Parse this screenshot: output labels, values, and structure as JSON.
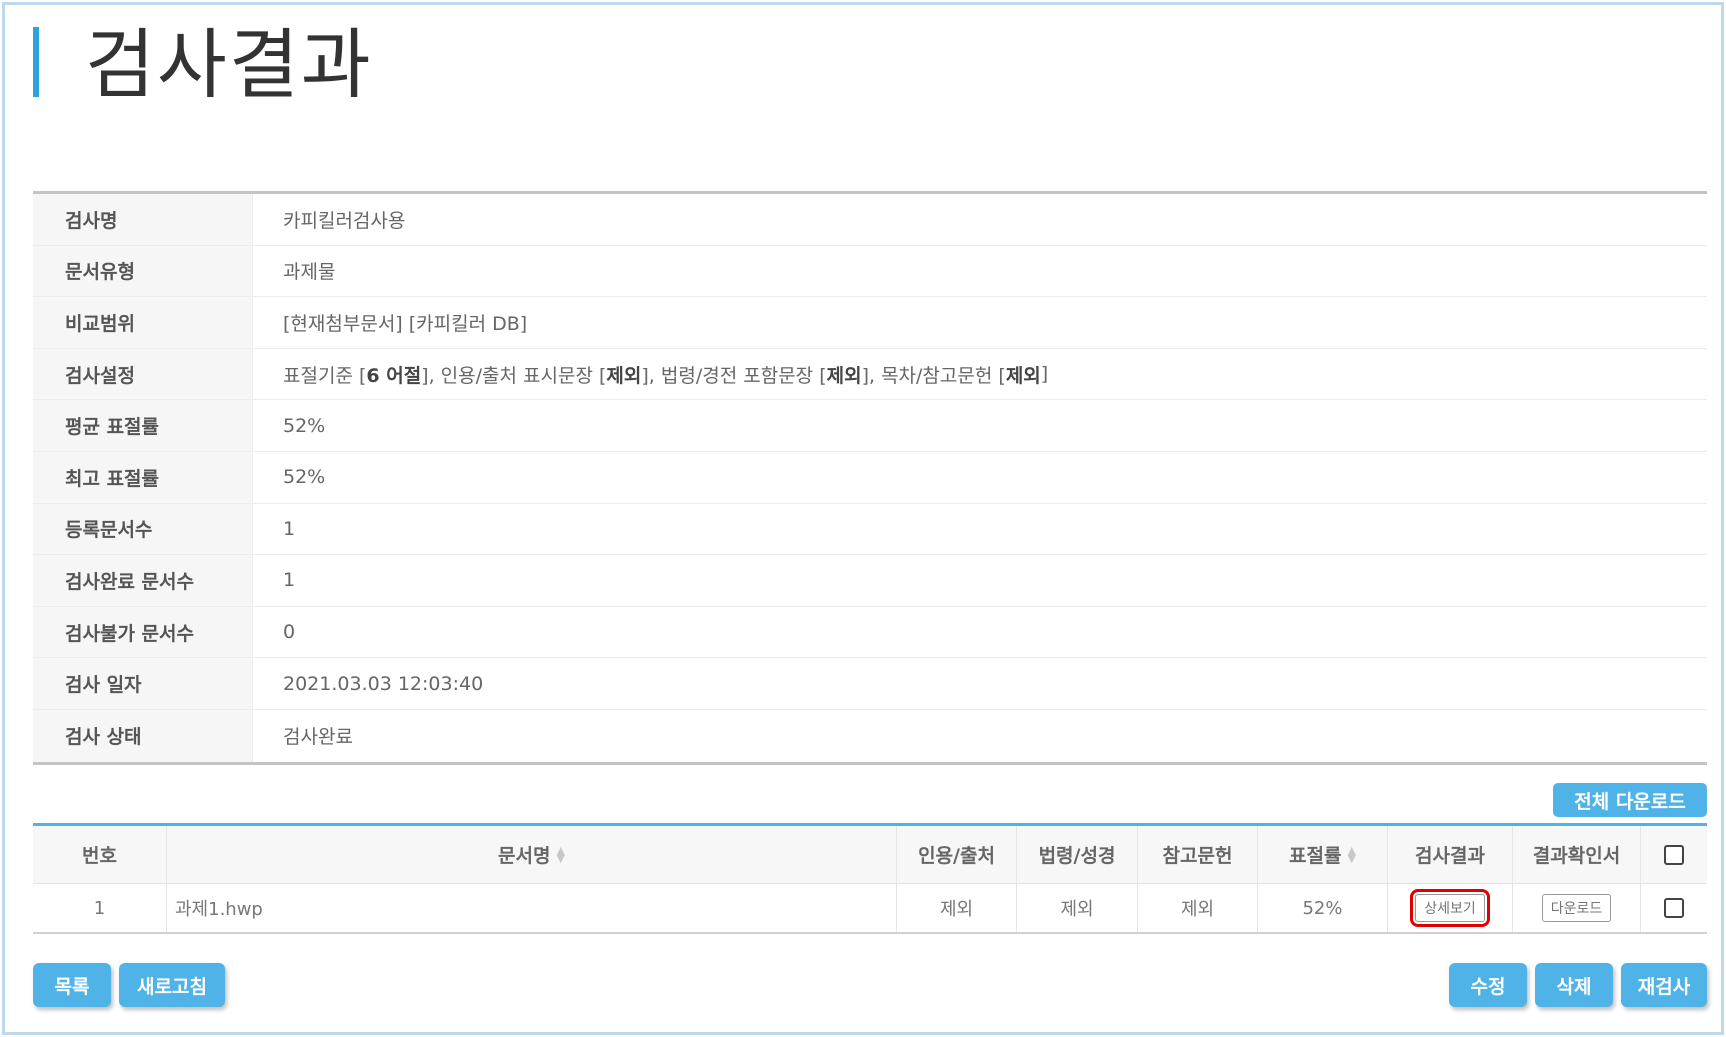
{
  "page": {
    "title": "검사결과"
  },
  "info": {
    "rows": [
      {
        "label": "검사명",
        "value": "카피킬러검사용"
      },
      {
        "label": "문서유형",
        "value": "과제물"
      },
      {
        "label": "비교범위",
        "value": "[현재첨부문서] [카피킬러 DB]"
      },
      {
        "label": "검사설정",
        "parts": [
          {
            "text": "표절기준 [",
            "bold": false
          },
          {
            "text": "6 어절",
            "bold": true
          },
          {
            "text": "], 인용/출처 표시문장 [",
            "bold": false
          },
          {
            "text": "제외",
            "bold": true
          },
          {
            "text": "], 법령/경전 포함문장 [",
            "bold": false
          },
          {
            "text": "제외",
            "bold": true
          },
          {
            "text": "], 목차/참고문헌 [",
            "bold": false
          },
          {
            "text": "제외",
            "bold": true
          },
          {
            "text": "]",
            "bold": false
          }
        ]
      },
      {
        "label": "평균 표절률",
        "value": "52%"
      },
      {
        "label": "최고 표절률",
        "value": "52%"
      },
      {
        "label": "등록문서수",
        "value": "1"
      },
      {
        "label": "검사완료 문서수",
        "value": "1"
      },
      {
        "label": "검사불가 문서수",
        "value": "0"
      },
      {
        "label": "검사 일자",
        "value": "2021.03.03 12:03:40"
      },
      {
        "label": "검사 상태",
        "value": "검사완료"
      }
    ]
  },
  "download_all_label": "전체 다운로드",
  "results": {
    "headers": [
      "번호",
      "문서명",
      "인용/출처",
      "법령/성경",
      "참고문헌",
      "표절률",
      "검사결과",
      "결과확인서"
    ],
    "rows": [
      {
        "no": "1",
        "name": "과제1.hwp",
        "citation": "제외",
        "law": "제외",
        "reference": "제외",
        "rate": "52%",
        "detail_label": "상세보기",
        "download_label": "다운로드"
      }
    ]
  },
  "footer": {
    "list_label": "목록",
    "refresh_label": "새로고침",
    "edit_label": "수정",
    "delete_label": "삭제",
    "recheck_label": "재검사"
  },
  "colors": {
    "accent": "#4fb3e8",
    "title_bar": "#2ea3dd",
    "highlight": "#e00000"
  }
}
